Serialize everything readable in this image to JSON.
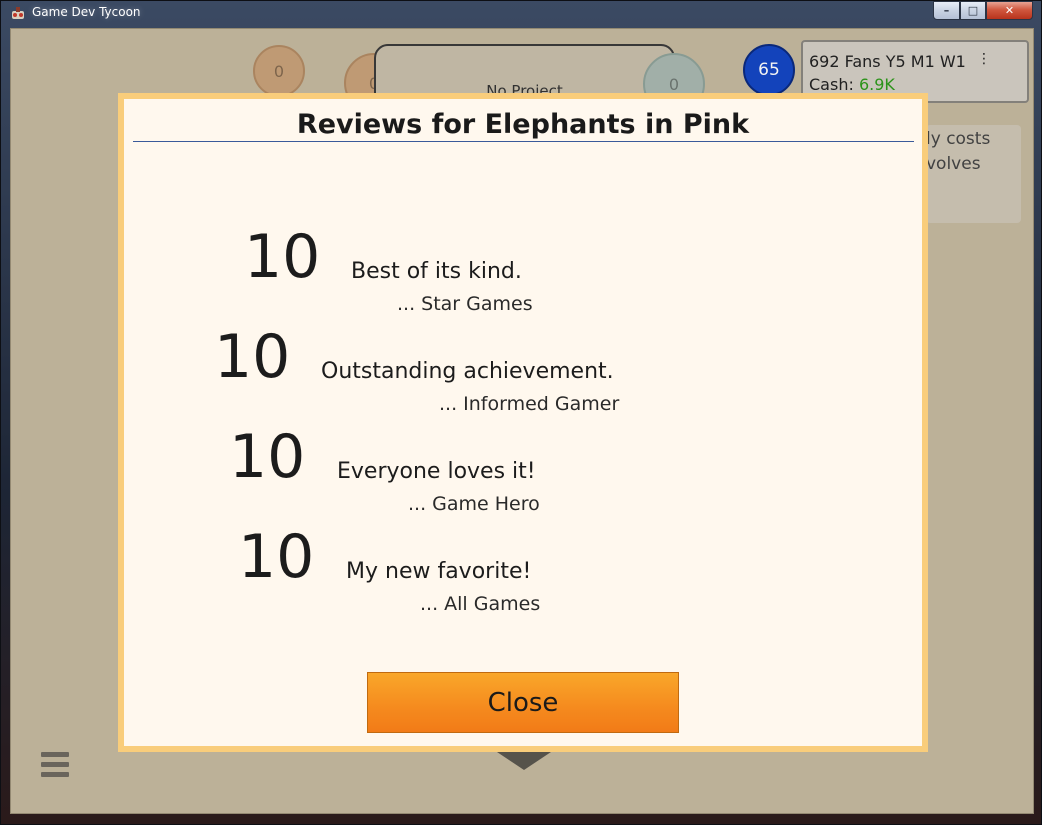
{
  "window": {
    "title": "Game Dev Tycoon",
    "controls": {
      "minimize": "–",
      "maximize": "□",
      "close": "✕"
    }
  },
  "hud": {
    "circle_left_value": "0",
    "circle_mid_value": "0",
    "circle_right_value": "0",
    "project_label": "No Project",
    "research_points": "65",
    "fans_line": "692 Fans Y5 M1 W1",
    "stats_dots": "⋮",
    "cash_label": "Cash: ",
    "cash_value": "6.9K",
    "cash_color": "#2d9a1a",
    "info_line1": "ly costs",
    "info_line2": "volves"
  },
  "dialog": {
    "title": "Reviews for Elephants in Pink",
    "reviews": [
      {
        "score": "10",
        "quote": "Best of its kind.",
        "source": "... Star Games"
      },
      {
        "score": "10",
        "quote": "Outstanding achievement.",
        "source": "... Informed Gamer"
      },
      {
        "score": "10",
        "quote": "Everyone loves it!",
        "source": "... Game Hero"
      },
      {
        "score": "10",
        "quote": "My new favorite!",
        "source": "... All Games"
      }
    ],
    "close_label": "Close"
  },
  "colors": {
    "dialog_border": "#f9cd7b",
    "close_button": "#f58a1e",
    "research_circle": "#1346c4"
  },
  "icons": {
    "app_icon": "game-dev-tycoon-icon",
    "menu_icon": "hamburger-icon",
    "arrow_icon": "chevron-down-icon"
  }
}
